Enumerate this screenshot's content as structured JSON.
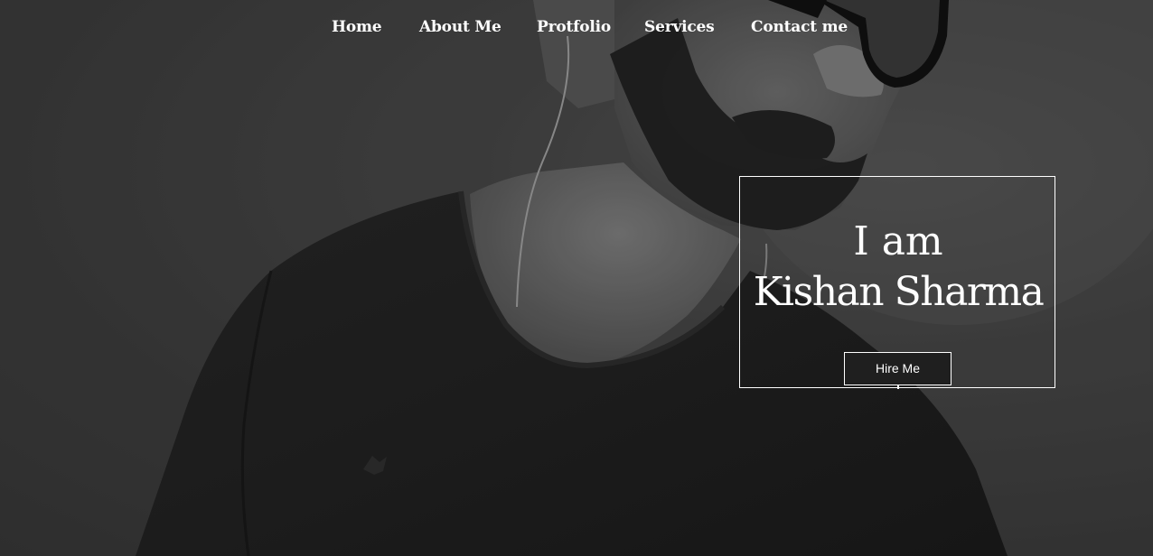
{
  "nav": {
    "items": [
      {
        "label": "Home"
      },
      {
        "label": "About Me"
      },
      {
        "label": "Protfolio"
      },
      {
        "label": "Services"
      },
      {
        "label": "Contact me"
      }
    ]
  },
  "hero": {
    "intro_line1": "I am",
    "intro_line2": "Kishan Sharma",
    "hire_button": "Hire Me"
  },
  "colors": {
    "text": "#ffffff",
    "background": "#3e3e3e",
    "shirt": "#1e1e1e"
  },
  "icons": [
    "portrait-photo"
  ]
}
